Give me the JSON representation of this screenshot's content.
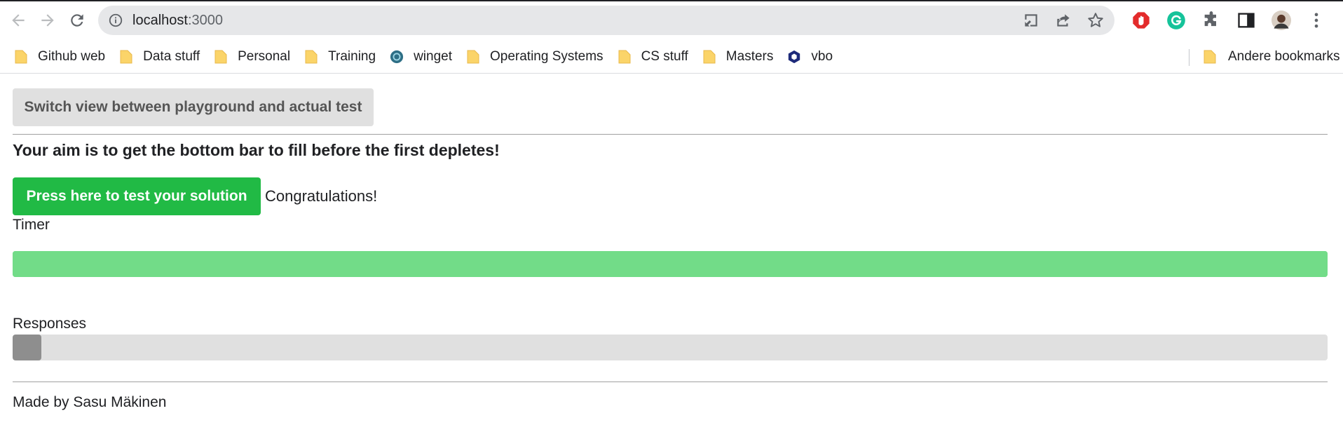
{
  "browser": {
    "url_host": "localhost",
    "url_port": ":3000",
    "bookmarks": [
      {
        "label": "Github web",
        "icon": "folder-icon"
      },
      {
        "label": "Data stuff",
        "icon": "folder-icon"
      },
      {
        "label": "Personal",
        "icon": "folder-icon"
      },
      {
        "label": "Training",
        "icon": "folder-icon"
      },
      {
        "label": "winget",
        "icon": "winget-icon"
      },
      {
        "label": "Operating Systems",
        "icon": "folder-icon"
      },
      {
        "label": "CS stuff",
        "icon": "folder-icon"
      },
      {
        "label": "Masters",
        "icon": "folder-icon"
      },
      {
        "label": "vbo",
        "icon": "vbo-icon"
      }
    ],
    "other_bookmarks": "Andere bookmarks"
  },
  "page": {
    "switch_button": "Switch view between playground and actual test",
    "aim": "Your aim is to get the bottom bar to fill before the first depletes!",
    "test_button": "Press here to test your solution",
    "status": "Congratulations!",
    "timer_label": "Timer",
    "timer_progress": 1.0,
    "responses_label": "Responses",
    "responses_progress": 0.022,
    "footer": "Made by Sasu Mäkinen"
  },
  "colors": {
    "success_green": "#21ba45",
    "timer_bar": "#6ddc87",
    "responses_bar": "#8e8e8e",
    "track_gray": "#e0e0e0"
  }
}
